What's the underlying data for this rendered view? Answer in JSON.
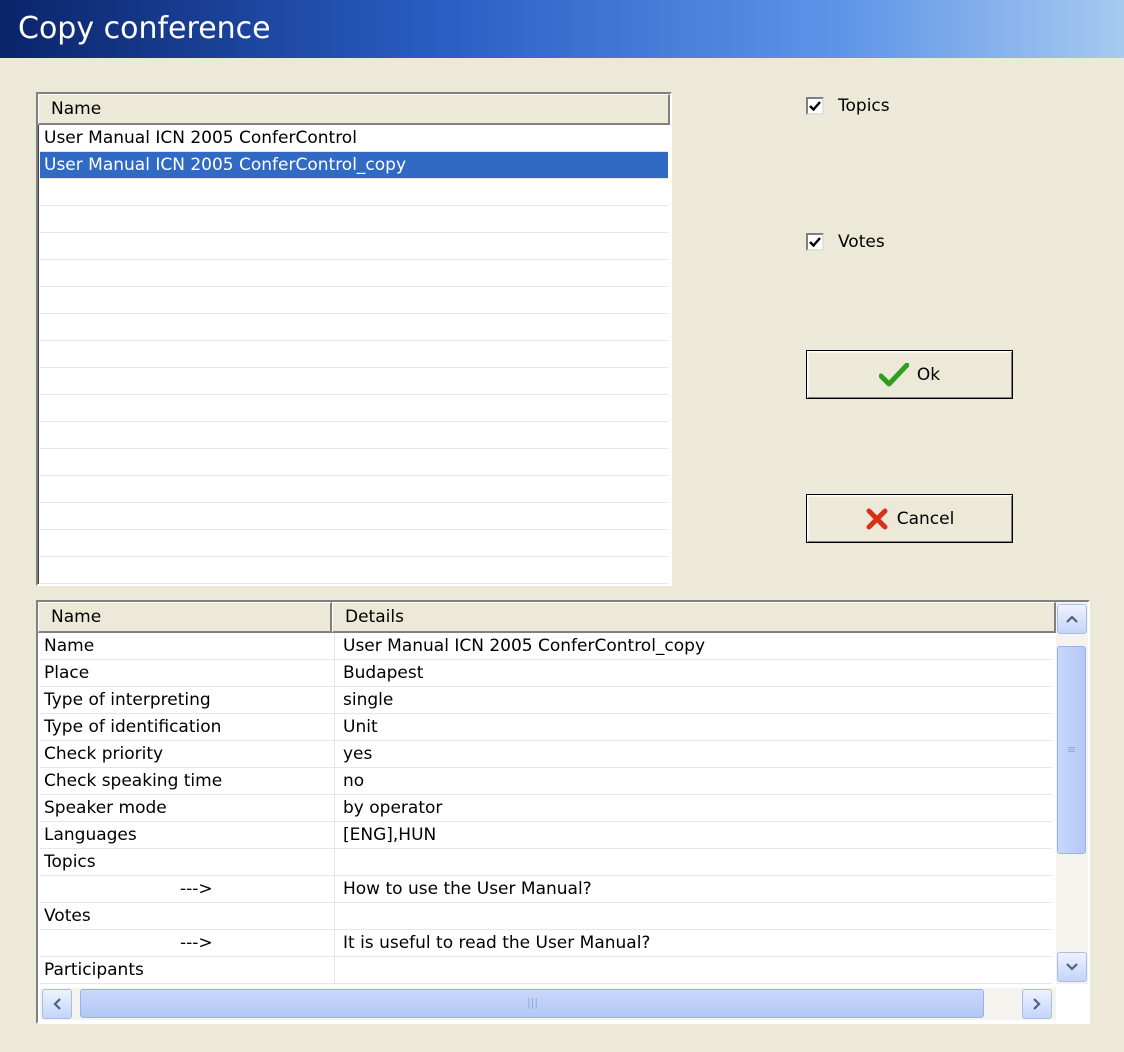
{
  "window": {
    "title": "Copy conference"
  },
  "conference_list": {
    "header": "Name",
    "rows": [
      "User Manual ICN 2005 ConferControl",
      "User Manual ICN 2005 ConferControl_copy"
    ],
    "selected_index": 1
  },
  "options": {
    "topics": {
      "label": "Topics",
      "checked": true
    },
    "votes": {
      "label": "Votes",
      "checked": true
    }
  },
  "buttons": {
    "ok": "Ok",
    "cancel": "Cancel"
  },
  "details": {
    "columns": [
      "Name",
      "Details"
    ],
    "rows": [
      {
        "name": "Name",
        "detail": "User Manual ICN 2005 ConferControl_copy"
      },
      {
        "name": "Place",
        "detail": "Budapest"
      },
      {
        "name": "Type of interpreting",
        "detail": "single"
      },
      {
        "name": "Type of identification",
        "detail": "Unit"
      },
      {
        "name": "Check priority",
        "detail": "yes"
      },
      {
        "name": "Check speaking time",
        "detail": "no"
      },
      {
        "name": "Speaker mode",
        "detail": "by operator"
      },
      {
        "name": "Languages",
        "detail": "[ENG],HUN"
      },
      {
        "name": "Topics",
        "detail": ""
      },
      {
        "name": "--->",
        "detail": "How to use the User Manual?"
      },
      {
        "name": "Votes",
        "detail": ""
      },
      {
        "name": "--->",
        "detail": "It is useful to read the User Manual?"
      },
      {
        "name": "Participants",
        "detail": ""
      }
    ]
  },
  "colors": {
    "selection": "#316ac5",
    "ok_check": "#2e9e1e",
    "cancel_x": "#d9301a"
  }
}
